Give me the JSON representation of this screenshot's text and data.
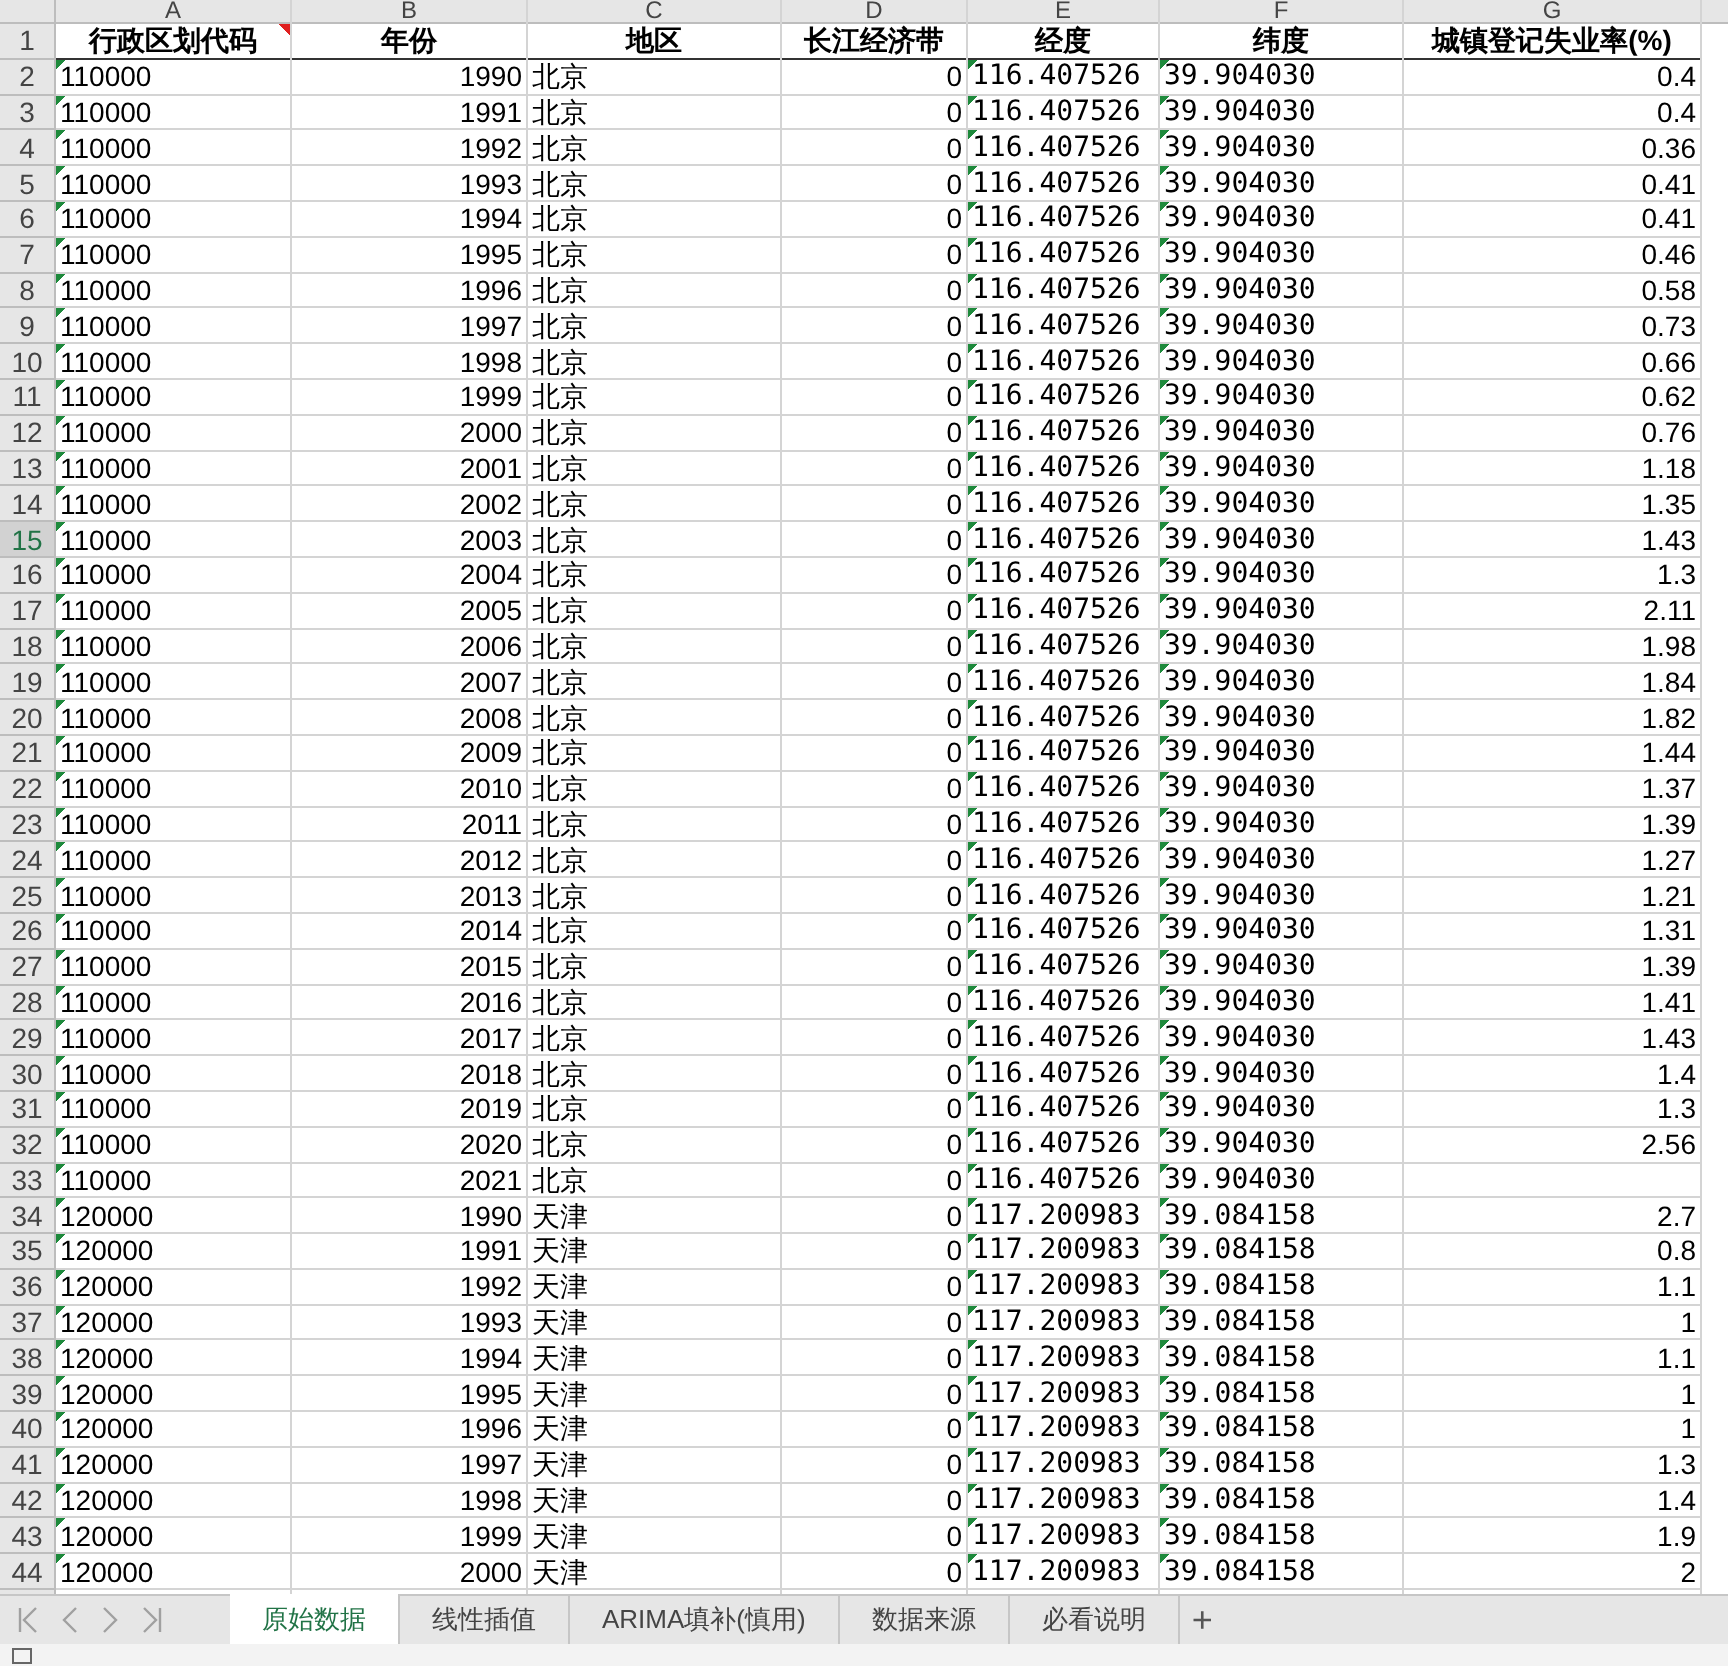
{
  "columns": [
    {
      "letter": "A",
      "title": "行政区划代码",
      "text_flag": true,
      "comment": true
    },
    {
      "letter": "B",
      "title": "年份",
      "text_flag": false,
      "comment": false
    },
    {
      "letter": "C",
      "title": "地区",
      "text_flag": false,
      "comment": false
    },
    {
      "letter": "D",
      "title": "长江经济带",
      "text_flag": false,
      "comment": false
    },
    {
      "letter": "E",
      "title": "经度",
      "text_flag": true,
      "comment": false
    },
    {
      "letter": "F",
      "title": "纬度",
      "text_flag": true,
      "comment": false
    },
    {
      "letter": "G",
      "title": "城镇登记失业率(%)",
      "text_flag": false,
      "comment": false
    }
  ],
  "header_row": "1",
  "rows": [
    {
      "row": "2",
      "cells": [
        "110000",
        "1990",
        "北京",
        "0",
        "116.407526",
        "39.904030",
        "0.4"
      ],
      "selected": false
    },
    {
      "row": "3",
      "cells": [
        "110000",
        "1991",
        "北京",
        "0",
        "116.407526",
        "39.904030",
        "0.4"
      ],
      "selected": false
    },
    {
      "row": "4",
      "cells": [
        "110000",
        "1992",
        "北京",
        "0",
        "116.407526",
        "39.904030",
        "0.36"
      ],
      "selected": false
    },
    {
      "row": "5",
      "cells": [
        "110000",
        "1993",
        "北京",
        "0",
        "116.407526",
        "39.904030",
        "0.41"
      ],
      "selected": false
    },
    {
      "row": "6",
      "cells": [
        "110000",
        "1994",
        "北京",
        "0",
        "116.407526",
        "39.904030",
        "0.41"
      ],
      "selected": false
    },
    {
      "row": "7",
      "cells": [
        "110000",
        "1995",
        "北京",
        "0",
        "116.407526",
        "39.904030",
        "0.46"
      ],
      "selected": false
    },
    {
      "row": "8",
      "cells": [
        "110000",
        "1996",
        "北京",
        "0",
        "116.407526",
        "39.904030",
        "0.58"
      ],
      "selected": false
    },
    {
      "row": "9",
      "cells": [
        "110000",
        "1997",
        "北京",
        "0",
        "116.407526",
        "39.904030",
        "0.73"
      ],
      "selected": false
    },
    {
      "row": "10",
      "cells": [
        "110000",
        "1998",
        "北京",
        "0",
        "116.407526",
        "39.904030",
        "0.66"
      ],
      "selected": false
    },
    {
      "row": "11",
      "cells": [
        "110000",
        "1999",
        "北京",
        "0",
        "116.407526",
        "39.904030",
        "0.62"
      ],
      "selected": false
    },
    {
      "row": "12",
      "cells": [
        "110000",
        "2000",
        "北京",
        "0",
        "116.407526",
        "39.904030",
        "0.76"
      ],
      "selected": false
    },
    {
      "row": "13",
      "cells": [
        "110000",
        "2001",
        "北京",
        "0",
        "116.407526",
        "39.904030",
        "1.18"
      ],
      "selected": false
    },
    {
      "row": "14",
      "cells": [
        "110000",
        "2002",
        "北京",
        "0",
        "116.407526",
        "39.904030",
        "1.35"
      ],
      "selected": false
    },
    {
      "row": "15",
      "cells": [
        "110000",
        "2003",
        "北京",
        "0",
        "116.407526",
        "39.904030",
        "1.43"
      ],
      "selected": true
    },
    {
      "row": "16",
      "cells": [
        "110000",
        "2004",
        "北京",
        "0",
        "116.407526",
        "39.904030",
        "1.3"
      ],
      "selected": false
    },
    {
      "row": "17",
      "cells": [
        "110000",
        "2005",
        "北京",
        "0",
        "116.407526",
        "39.904030",
        "2.11"
      ],
      "selected": false
    },
    {
      "row": "18",
      "cells": [
        "110000",
        "2006",
        "北京",
        "0",
        "116.407526",
        "39.904030",
        "1.98"
      ],
      "selected": false
    },
    {
      "row": "19",
      "cells": [
        "110000",
        "2007",
        "北京",
        "0",
        "116.407526",
        "39.904030",
        "1.84"
      ],
      "selected": false
    },
    {
      "row": "20",
      "cells": [
        "110000",
        "2008",
        "北京",
        "0",
        "116.407526",
        "39.904030",
        "1.82"
      ],
      "selected": false
    },
    {
      "row": "21",
      "cells": [
        "110000",
        "2009",
        "北京",
        "0",
        "116.407526",
        "39.904030",
        "1.44"
      ],
      "selected": false
    },
    {
      "row": "22",
      "cells": [
        "110000",
        "2010",
        "北京",
        "0",
        "116.407526",
        "39.904030",
        "1.37"
      ],
      "selected": false
    },
    {
      "row": "23",
      "cells": [
        "110000",
        "2011",
        "北京",
        "0",
        "116.407526",
        "39.904030",
        "1.39"
      ],
      "selected": false
    },
    {
      "row": "24",
      "cells": [
        "110000",
        "2012",
        "北京",
        "0",
        "116.407526",
        "39.904030",
        "1.27"
      ],
      "selected": false
    },
    {
      "row": "25",
      "cells": [
        "110000",
        "2013",
        "北京",
        "0",
        "116.407526",
        "39.904030",
        "1.21"
      ],
      "selected": false
    },
    {
      "row": "26",
      "cells": [
        "110000",
        "2014",
        "北京",
        "0",
        "116.407526",
        "39.904030",
        "1.31"
      ],
      "selected": false
    },
    {
      "row": "27",
      "cells": [
        "110000",
        "2015",
        "北京",
        "0",
        "116.407526",
        "39.904030",
        "1.39"
      ],
      "selected": false
    },
    {
      "row": "28",
      "cells": [
        "110000",
        "2016",
        "北京",
        "0",
        "116.407526",
        "39.904030",
        "1.41"
      ],
      "selected": false
    },
    {
      "row": "29",
      "cells": [
        "110000",
        "2017",
        "北京",
        "0",
        "116.407526",
        "39.904030",
        "1.43"
      ],
      "selected": false
    },
    {
      "row": "30",
      "cells": [
        "110000",
        "2018",
        "北京",
        "0",
        "116.407526",
        "39.904030",
        "1.4"
      ],
      "selected": false
    },
    {
      "row": "31",
      "cells": [
        "110000",
        "2019",
        "北京",
        "0",
        "116.407526",
        "39.904030",
        "1.3"
      ],
      "selected": false
    },
    {
      "row": "32",
      "cells": [
        "110000",
        "2020",
        "北京",
        "0",
        "116.407526",
        "39.904030",
        "2.56"
      ],
      "selected": false
    },
    {
      "row": "33",
      "cells": [
        "110000",
        "2021",
        "北京",
        "0",
        "116.407526",
        "39.904030"
      ],
      "selected": false
    },
    {
      "row": "34",
      "cells": [
        "120000",
        "1990",
        "天津",
        "0",
        "117.200983",
        "39.084158",
        "2.7"
      ],
      "selected": false
    },
    {
      "row": "35",
      "cells": [
        "120000",
        "1991",
        "天津",
        "0",
        "117.200983",
        "39.084158",
        "0.8"
      ],
      "selected": false
    },
    {
      "row": "36",
      "cells": [
        "120000",
        "1992",
        "天津",
        "0",
        "117.200983",
        "39.084158",
        "1.1"
      ],
      "selected": false
    },
    {
      "row": "37",
      "cells": [
        "120000",
        "1993",
        "天津",
        "0",
        "117.200983",
        "39.084158",
        "1"
      ],
      "selected": false
    },
    {
      "row": "38",
      "cells": [
        "120000",
        "1994",
        "天津",
        "0",
        "117.200983",
        "39.084158",
        "1.1"
      ],
      "selected": false
    },
    {
      "row": "39",
      "cells": [
        "120000",
        "1995",
        "天津",
        "0",
        "117.200983",
        "39.084158",
        "1"
      ],
      "selected": false
    },
    {
      "row": "40",
      "cells": [
        "120000",
        "1996",
        "天津",
        "0",
        "117.200983",
        "39.084158",
        "1"
      ],
      "selected": false
    },
    {
      "row": "41",
      "cells": [
        "120000",
        "1997",
        "天津",
        "0",
        "117.200983",
        "39.084158",
        "1.3"
      ],
      "selected": false
    },
    {
      "row": "42",
      "cells": [
        "120000",
        "1998",
        "天津",
        "0",
        "117.200983",
        "39.084158",
        "1.4"
      ],
      "selected": false
    },
    {
      "row": "43",
      "cells": [
        "120000",
        "1999",
        "天津",
        "0",
        "117.200983",
        "39.084158",
        "1.9"
      ],
      "selected": false
    },
    {
      "row": "44",
      "cells": [
        "120000",
        "2000",
        "天津",
        "0",
        "117.200983",
        "39.084158",
        "2"
      ],
      "selected": false
    }
  ],
  "sheet_tabs": [
    {
      "label": "原始数据",
      "selected": true
    },
    {
      "label": "线性插值",
      "selected": false
    },
    {
      "label": "ARIMA填补(慎用)",
      "selected": false
    },
    {
      "label": "数据来源",
      "selected": false
    },
    {
      "label": "必看说明",
      "selected": false
    }
  ],
  "add_sheet": "+"
}
